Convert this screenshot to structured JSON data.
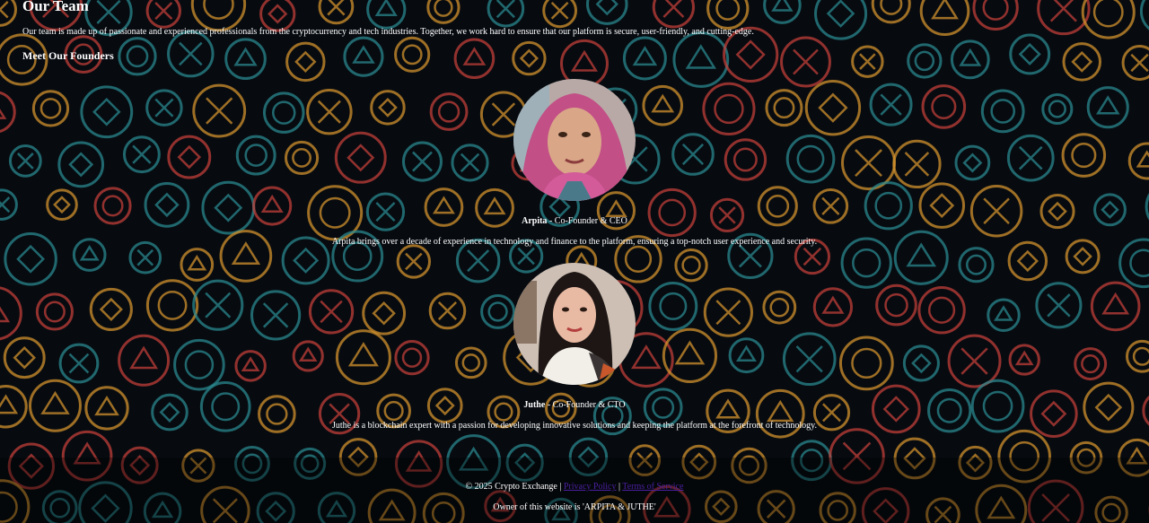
{
  "team": {
    "title": "Our Team",
    "description": "Our team is made up of passionate and experienced professionals from the cryptocurrency and tech industries. Together, we work hard to ensure that our platform is secure, user-friendly, and cutting-edge.",
    "founders_heading": "Meet Our Founders"
  },
  "founders": [
    {
      "name": "Arpita",
      "role": " - Co-Founder & CEO",
      "bio": "Arpita brings over a decade of experience in technology and finance to the platform, ensuring a top-notch user experience and security."
    },
    {
      "name": "Juthe",
      "role": " - Co-Founder & CTO",
      "bio": "Juthe is a blockchain expert with a passion for developing innovative solutions and keeping the platform at the forefront of technology."
    }
  ],
  "footer": {
    "copyright": "© 2025 Crypto Exchange | ",
    "privacy_link": "Privacy Policy",
    "separator": " | ",
    "terms_link": "Terms of Service",
    "owner": "Owner of this website is 'ARPITA & JUTHE'"
  },
  "colors": {
    "background": "#070b10",
    "teal": "#2a8c93",
    "orange": "#d9962e",
    "red": "#c8403a",
    "link": "#4a1fa0"
  }
}
